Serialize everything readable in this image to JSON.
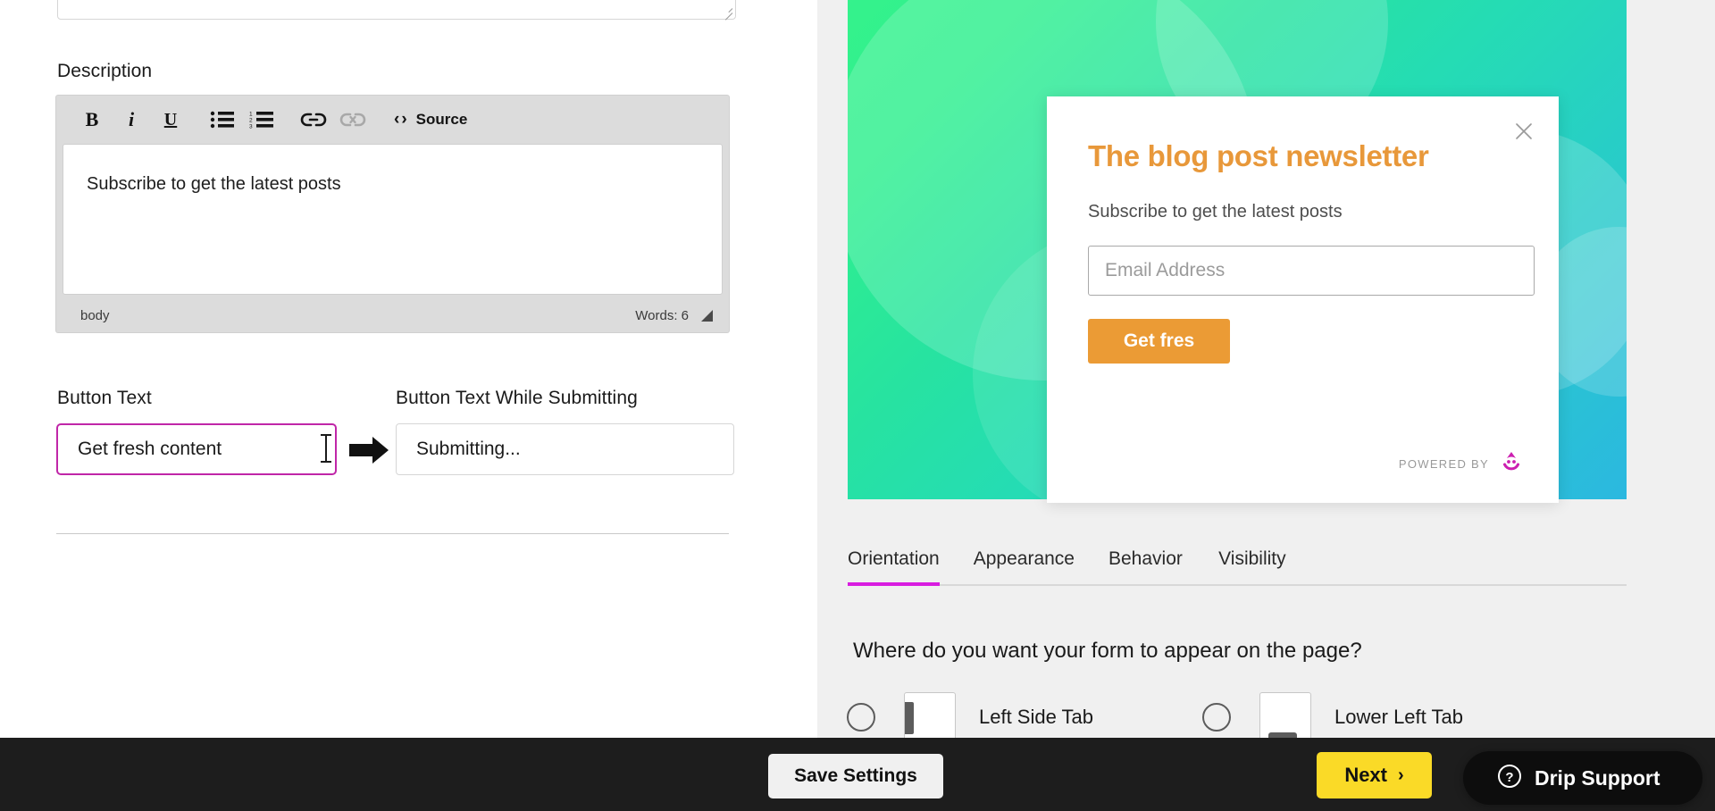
{
  "editor_panel": {
    "description_label": "Description",
    "toolbar": {
      "bold": "B",
      "italic": "i",
      "underline": "U",
      "bulleted_list": "bulleted-list-icon",
      "numbered_list": "numbered-list-icon",
      "link": "link-icon",
      "unlink": "unlink-icon",
      "source_label": "Source"
    },
    "description_value": "Subscribe to get the latest posts",
    "status": {
      "element_path": "body",
      "word_count": "Words: 6"
    },
    "button_text": {
      "label": "Button Text",
      "value": "Get fresh content"
    },
    "button_text_submitting": {
      "label": "Button Text While Submitting",
      "value": "Submitting..."
    }
  },
  "preview": {
    "form": {
      "heading": "The blog post newsletter",
      "subheading": "Subscribe to get the latest posts",
      "email_placeholder": "Email Address",
      "email_value": "",
      "submit_label": "Get fres",
      "close_label": "Close",
      "powered_by": "POWERED BY"
    },
    "tabs": [
      {
        "label": "Orientation",
        "active": true
      },
      {
        "label": "Appearance",
        "active": false
      },
      {
        "label": "Behavior",
        "active": false
      },
      {
        "label": "Visibility",
        "active": false
      }
    ],
    "question": "Where do you want your form to appear on the page?",
    "options": [
      {
        "label": "Left Side Tab",
        "selected": false,
        "thumb": "left-side-tab-thumb"
      },
      {
        "label": "Lower Left Tab",
        "selected": false,
        "thumb": "lower-left-tab-thumb"
      }
    ]
  },
  "bottom_bar": {
    "save_label": "Save Settings",
    "next_label": "Next",
    "next_chevron": "›"
  },
  "support_widget": {
    "label": "Drip Support",
    "icon": "question-circle-icon"
  },
  "colors": {
    "accent_magenta": "#d81ce0",
    "focus_border": "#c026a8",
    "form_orange": "#eb9b35",
    "next_yellow": "#fada27",
    "bar_dark": "#1d1d1d",
    "hero_gradient_start": "#35f28c",
    "hero_gradient_end": "#2bb8e0",
    "drip_logo": "#cc1fb0"
  }
}
